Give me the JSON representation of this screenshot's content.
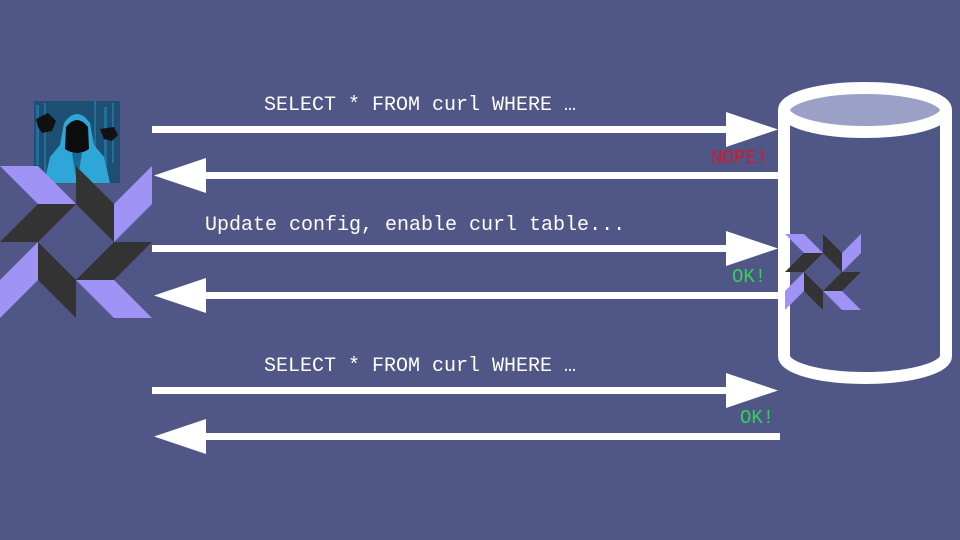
{
  "messages": {
    "m1": "SELECT * FROM curl WHERE …",
    "m2": "Update config, enable curl table...",
    "m3": "SELECT * FROM curl WHERE …"
  },
  "responses": {
    "r1": "NOPE!",
    "r2": "OK!",
    "r3": "OK!"
  },
  "colors": {
    "background": "#505787",
    "arrow": "#ffffff",
    "nope": "#d0182b",
    "ok": "#2fd35a",
    "logo_light": "#9f93f5",
    "logo_dark": "#333333",
    "hoodie": "#2fa6d8"
  },
  "icons": {
    "attacker": "hooded-hacker-avatar",
    "client_logo": "pinwheel-logo",
    "database": "database-cylinder-icon",
    "db_logo": "pinwheel-logo"
  }
}
